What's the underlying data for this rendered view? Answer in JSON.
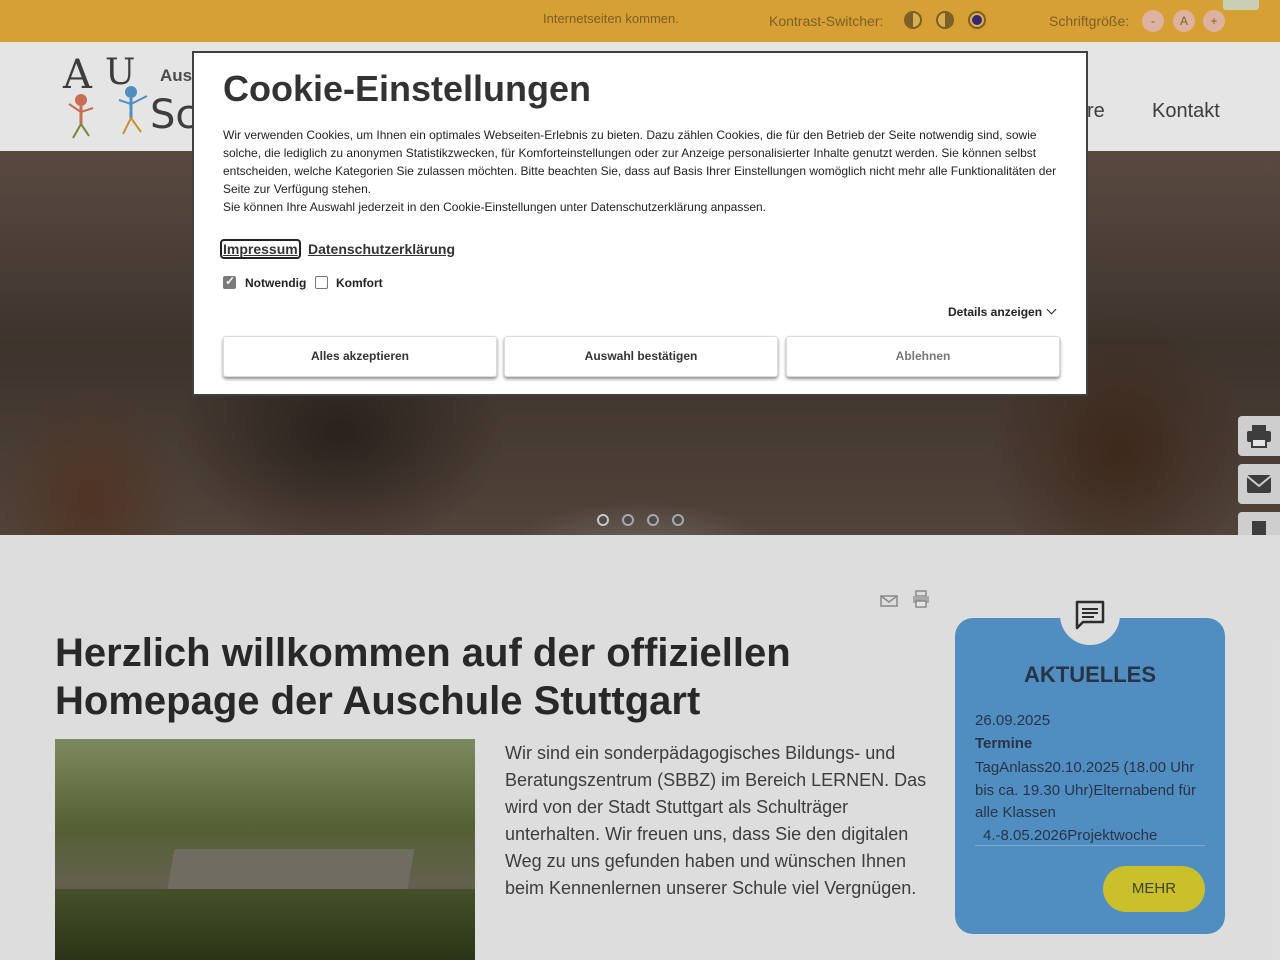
{
  "topbar": {
    "text": "Internetseiten kommen.",
    "contrast_label": "Kontrast-Switcher:",
    "fontsize_label": "Schriftgröße:",
    "fontsize_buttons": [
      "-",
      "A",
      "+"
    ]
  },
  "header": {
    "logo_line1": "Aus",
    "logo_line2": "Sc",
    "nav": [
      "re",
      "Kontakt"
    ]
  },
  "cookie": {
    "title": "Cookie-Einstellungen",
    "text": "Wir verwenden Cookies, um Ihnen ein optimales Webseiten-Erlebnis zu bieten. Dazu zählen Cookies, die für den Betrieb der Seite notwendig sind, sowie solche, die lediglich zu anonymen Statistikzwecken, für Komforteinstellungen oder zur Anzeige personalisierter Inhalte genutzt werden. Sie können selbst entscheiden, welche Kategorien Sie zulassen möchten. Bitte beachten Sie, dass auf Basis Ihrer Einstellungen womöglich nicht mehr alle Funktionalitäten der Seite zur Verfügung stehen.",
    "text2": "Sie können Ihre Auswahl jederzeit in den Cookie-Einstellungen unter Datenschutzerklärung anpassen.",
    "links": [
      "Impressum",
      "Datenschutzerklärung"
    ],
    "checkboxes": [
      {
        "label": "Notwendig",
        "checked": true
      },
      {
        "label": "Komfort",
        "checked": false
      }
    ],
    "details_label": "Details anzeigen",
    "buttons": [
      "Alles akzeptieren",
      "Auswahl bestätigen",
      "Ablehnen"
    ]
  },
  "main": {
    "title": "Herzlich willkommen auf der offiziellen Homepage der Auschule Stuttgart",
    "intro": "Wir sind ein sonderpädagogisches Bildungs- und Beratungszentrum (SBBZ) im Bereich LERNEN. Das wird von der Stadt Stuttgart als Schulträger unterhalten. Wir freuen uns, dass Sie den digitalen Weg zu uns gefunden haben und wünschen Ihnen beim Kennenlernen unserer Schule viel Vergnügen."
  },
  "news": {
    "heading": "AKTUELLES",
    "date": "26.09.2025",
    "title": "Termine",
    "body": "TagAnlass20.10.2025 (18.00 Uhr bis ca. 19.30 Uhr)Elternabend für alle Klassen",
    "body2": "4.-8.05.2026Projektwoche",
    "more": "MEHR"
  },
  "colors": {
    "topbar": "#f0b33a",
    "news_card": "#5a9fd8",
    "more_button": "#e0d630"
  },
  "icons": [
    "print-icon",
    "mail-icon",
    "bookmark-icon",
    "chat-icon",
    "envelope-icon"
  ]
}
